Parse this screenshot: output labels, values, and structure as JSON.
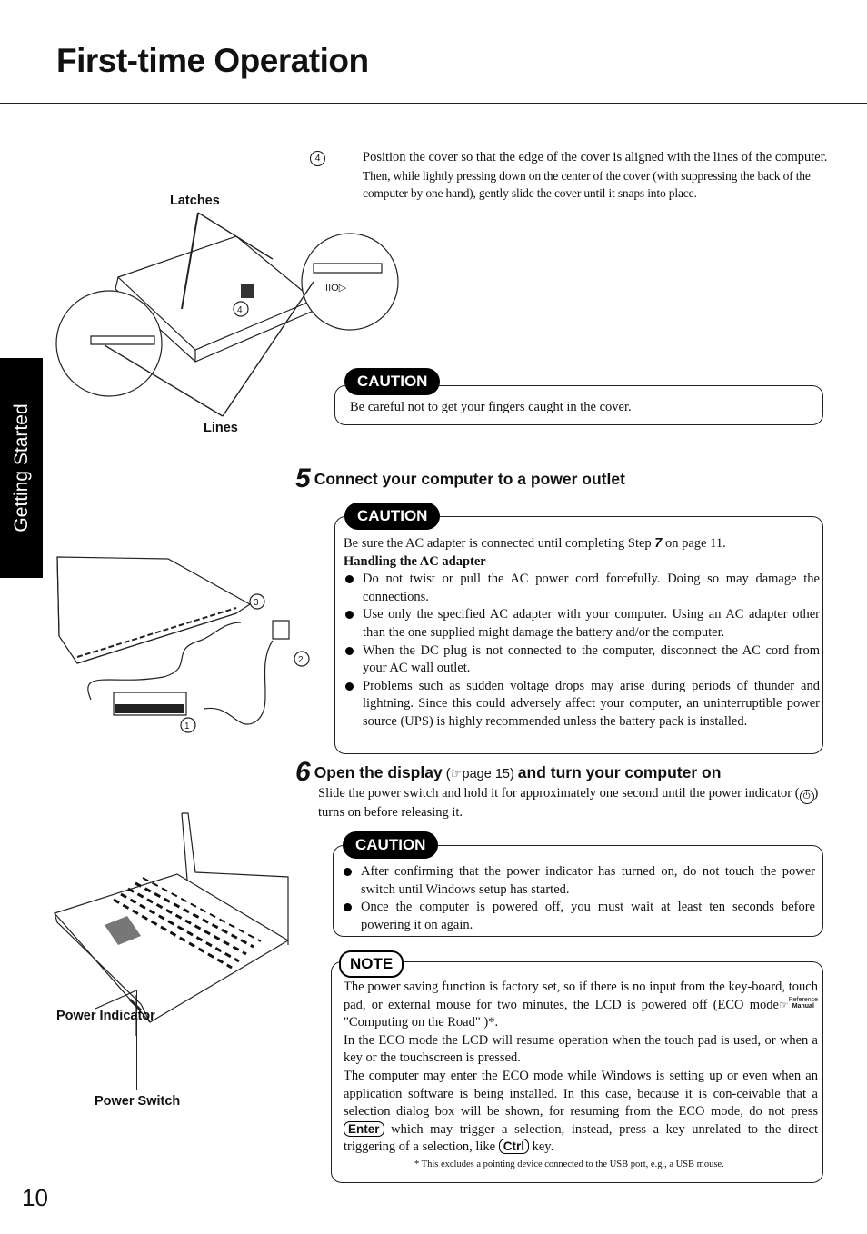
{
  "page": {
    "title": "First-time Operation",
    "side_tab": "Getting Started",
    "page_number": "10"
  },
  "figure1": {
    "labels": {
      "latches": "Latches",
      "lines": "Lines",
      "step_marker": "4"
    }
  },
  "step4": {
    "marker": "4",
    "text": "Position the cover so that the edge of the cover is aligned with the lines of the computer.",
    "subtext": "Then, while lightly pressing down on the center of the cover (with suppressing the back of the computer by one hand), gently slide the cover until it snaps into place."
  },
  "caution1": {
    "heading": "CAUTION",
    "text": "Be careful not to get your fingers caught in the cover."
  },
  "step5": {
    "number": "5",
    "title": "Connect your computer to a power outlet",
    "caution": {
      "heading": "CAUTION",
      "intro_before": "Be sure the AC adapter is connected until completing Step ",
      "intro_step": "7",
      "intro_after": " on page 11.",
      "subheading": "Handling the AC adapter",
      "bullets": [
        "Do not twist or pull the AC power cord forcefully.  Doing so may damage the connections.",
        "Use only the specified AC adapter with your computer.  Using an AC adapter other than the one supplied might damage the battery and/or the computer.",
        "When the DC plug is not connected to the computer, disconnect the AC cord from your AC wall outlet.",
        "Problems such as sudden voltage drops may arise during periods of thunder and lightning.  Since this could adversely affect your computer, an uninterruptible power source (UPS) is highly recommended unless the battery pack is installed."
      ]
    }
  },
  "figure2": {
    "markers": [
      "1",
      "2",
      "3"
    ]
  },
  "step6": {
    "number": "6",
    "title_part1": "Open the display",
    "title_ref": "page 15",
    "title_part2": "and turn your computer on",
    "text_before": "Slide the power switch and hold it for approximately one second until the power indicator (",
    "text_after": ") turns on before releasing it.",
    "caution": {
      "heading": "CAUTION",
      "bullets": [
        "After confirming that the power indicator has turned on, do not touch the power switch until Windows setup has started.",
        "Once the computer is powered off, you must wait at least ten seconds before powering it on again."
      ]
    }
  },
  "figure3": {
    "labels": {
      "power_indicator": "Power Indicator",
      "power_switch": "Power Switch"
    }
  },
  "note": {
    "heading": "NOTE",
    "para1_before": "The power saving function is factory set, so if there is no input from the key-board, touch pad, or external mouse for two minutes,  the LCD is powered off (ECO mode",
    "para1_ref_top": "Reference",
    "para1_ref_bottom": "Manual",
    "para1_after": " \"Computing on the Road\" )*.",
    "para2": "In the ECO mode the LCD will resume operation when the touch pad is used,  or when a key or the touchscreen is pressed.",
    "para3_before": "The computer may enter the ECO mode while Windows is setting up or even when an application software is being installed.  In this case, because it is con-ceivable that a selection dialog box will be shown, for resuming from the ECO mode, do not press ",
    "key_enter": "Enter",
    "para3_middle": " which may trigger a selection,  instead, press a key unrelated to the direct triggering of a selection, like ",
    "key_ctrl": "Ctrl",
    "para3_after": " key.",
    "footnote": "*   This excludes a pointing device connected to the USB port, e.g., a USB mouse."
  }
}
